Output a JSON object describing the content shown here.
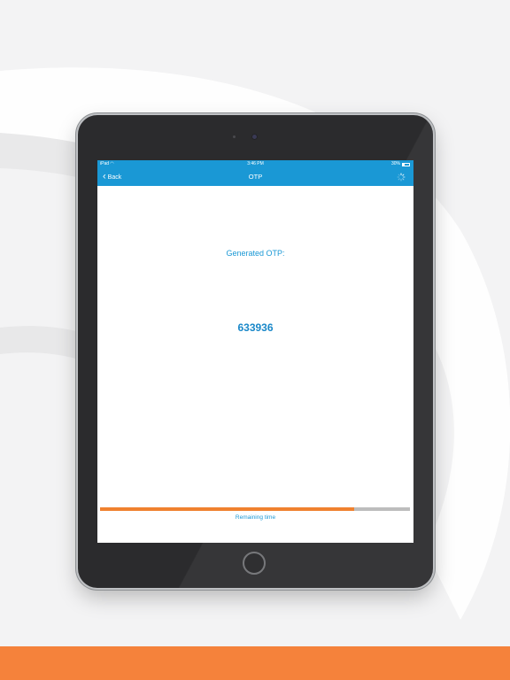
{
  "status_bar": {
    "carrier": "iPad",
    "time": "3:46 PM",
    "battery": "30%"
  },
  "nav": {
    "back_label": "Back",
    "title": "OTP"
  },
  "content": {
    "label": "Generated OTP:",
    "otp_code": "633936",
    "remaining_label": "Remaining time",
    "remaining_fraction": 0.82
  },
  "colors": {
    "accent_blue": "#1a98d5",
    "progress_orange": "#f0812f",
    "band_orange": "#f5823b"
  },
  "icons": {
    "back": "chevron-left-icon",
    "activity": "spinner-icon",
    "wifi": "wifi-icon",
    "battery": "battery-icon"
  }
}
